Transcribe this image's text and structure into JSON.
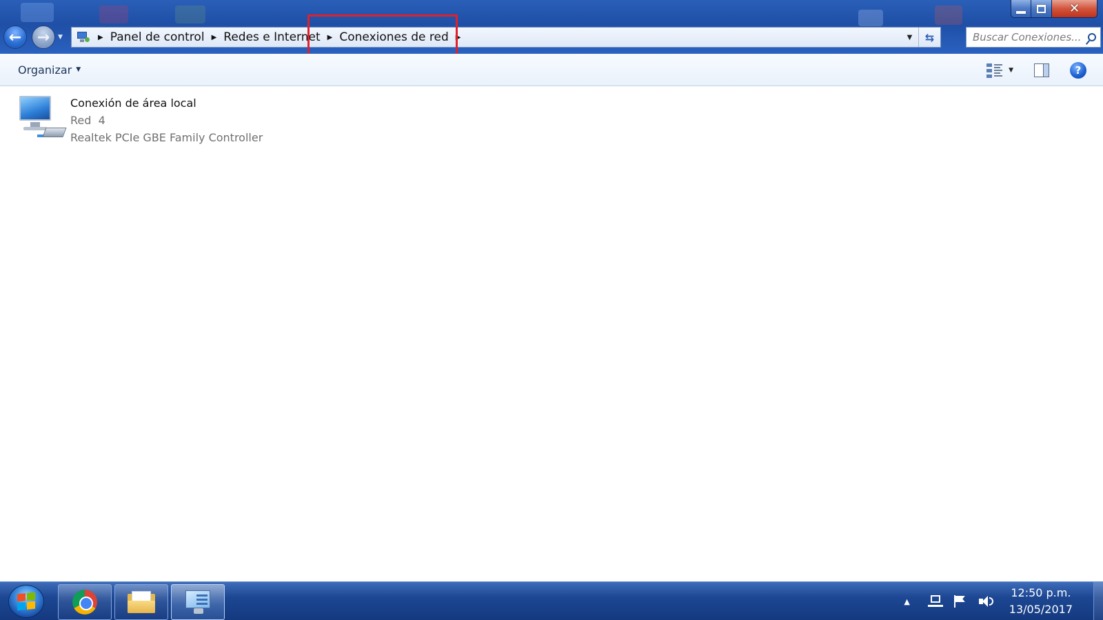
{
  "window": {
    "controls": {
      "minimize": "",
      "maximize": "",
      "close": "✕"
    }
  },
  "nav": {
    "back": "←",
    "forward": "→"
  },
  "address_bar": {
    "breadcrumbs": [
      "Panel de control",
      "Redes e Internet",
      "Conexiones de red"
    ]
  },
  "search": {
    "placeholder": "Buscar Conexiones..."
  },
  "command_bar": {
    "organize_label": "Organizar"
  },
  "connections": [
    {
      "name": "Conexión de área local",
      "network": "Red  4",
      "adapter": "Realtek PCIe GBE Family Controller",
      "icon": "network-connection-icon"
    }
  ],
  "taskbar": {
    "pinned": [
      "chrome-icon",
      "file-explorer-icon",
      "control-panel-icon"
    ],
    "tray": {
      "time": "12:50 p.m.",
      "date": "13/05/2017"
    }
  },
  "colors": {
    "highlight_border": "#e0202a",
    "taskbar": "#1d4793",
    "accent": "#2a5fb8"
  }
}
